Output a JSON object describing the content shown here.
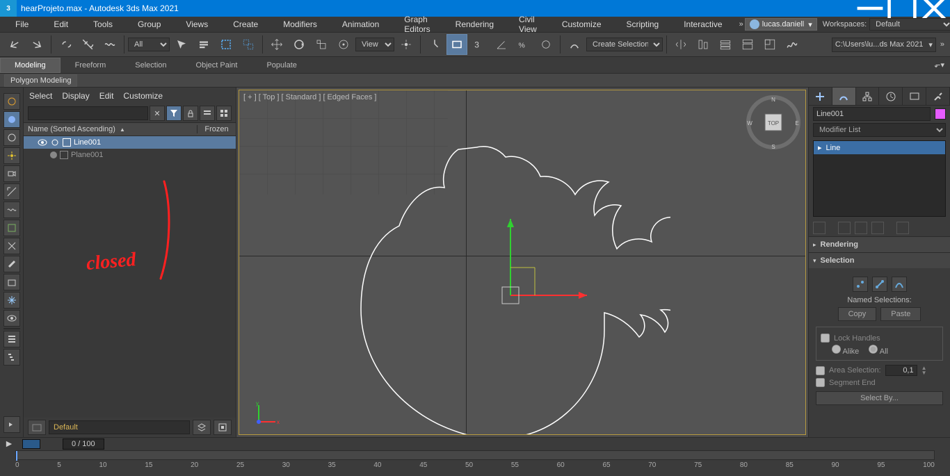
{
  "titlebar": {
    "filename": "hearProjeto.max",
    "app": "Autodesk 3ds Max 2021"
  },
  "menu": [
    "File",
    "Edit",
    "Tools",
    "Group",
    "Views",
    "Create",
    "Modifiers",
    "Animation",
    "Graph Editors",
    "Rendering",
    "Civil View",
    "Customize",
    "Scripting",
    "Interactive"
  ],
  "user": "lucas.daniell",
  "workspaces": {
    "label": "Workspaces:",
    "value": "Default"
  },
  "toolbar": {
    "filter_dd": "All",
    "view_dd": "View",
    "selset_dd": "Create Selection Se",
    "path": "C:\\Users\\lu...ds Max 2021"
  },
  "ribbon": {
    "tabs": [
      "Modeling",
      "Freeform",
      "Selection",
      "Object Paint",
      "Populate"
    ],
    "sub": "Polygon Modeling"
  },
  "scene": {
    "menus": [
      "Select",
      "Display",
      "Edit",
      "Customize"
    ],
    "header": {
      "name": "Name (Sorted Ascending)",
      "frozen": "Frozen"
    },
    "items": [
      {
        "name": "Line001",
        "selected": true
      },
      {
        "name": "Plane001",
        "selected": false
      }
    ],
    "layer": "Default",
    "annotation": "closed"
  },
  "viewport": {
    "label": "[ + ] [ Top ] [ Standard ] [ Edged Faces ]"
  },
  "cmd": {
    "obj_name": "Line001",
    "modlist_placeholder": "Modifier List",
    "stack": "Line",
    "rollouts": {
      "rendering": "Rendering",
      "selection": "Selection",
      "named_selections": "Named Selections:",
      "copy": "Copy",
      "paste": "Paste",
      "lock_handles": "Lock Handles",
      "alike": "Alike",
      "all": "All",
      "area_selection": "Area Selection:",
      "area_value": "0,1",
      "segment_end": "Segment End",
      "select_by": "Select By..."
    }
  },
  "timeline": {
    "frame": "0 / 100",
    "ticks": [
      "0",
      "5",
      "10",
      "15",
      "20",
      "25",
      "30",
      "35",
      "40",
      "45",
      "50",
      "55",
      "60",
      "65",
      "70",
      "75",
      "80",
      "85",
      "90",
      "95",
      "100"
    ]
  }
}
